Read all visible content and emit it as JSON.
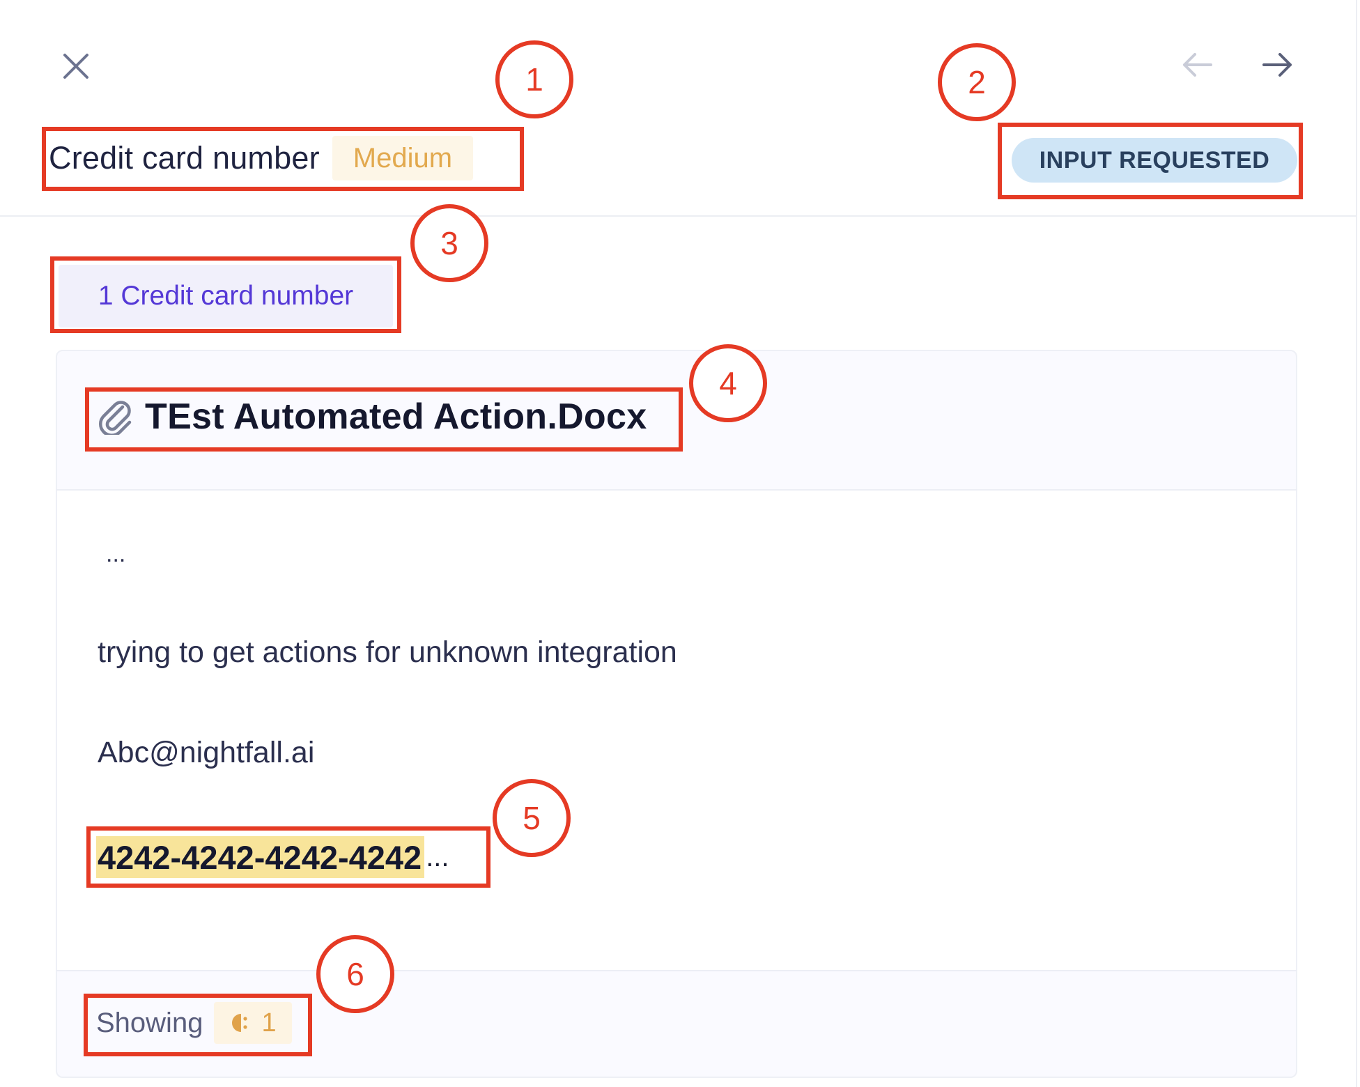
{
  "header": {
    "close_icon": "close-icon",
    "prev_icon": "arrow-left-icon",
    "next_icon": "arrow-right-icon",
    "detector_name": "Credit card number",
    "severity": "Medium",
    "status": "INPUT REQUESTED"
  },
  "findings_chip": "1 Credit card number",
  "card": {
    "attachment_icon": "paperclip-icon",
    "file_name": "TEst Automated Action.Docx",
    "snippet": {
      "leading_ellipsis": "...",
      "line1": "trying to get actions for unknown integration",
      "line2": "Abc@nightfall.ai",
      "match": "4242-4242-4242-4242",
      "trailing_ellipsis": "..."
    },
    "footer": {
      "label": "Showing",
      "count": "1",
      "count_icon": "masked-finding-icon"
    }
  },
  "annotations": [
    "1",
    "2",
    "3",
    "4",
    "5",
    "6"
  ],
  "colors": {
    "annotation": "#e53a24",
    "severity_text": "#e2a94e",
    "severity_bg": "#fdf6e7",
    "status_bg": "#cfe5f6",
    "chip_text": "#5438d6",
    "match_highlight": "#f8e49a"
  }
}
